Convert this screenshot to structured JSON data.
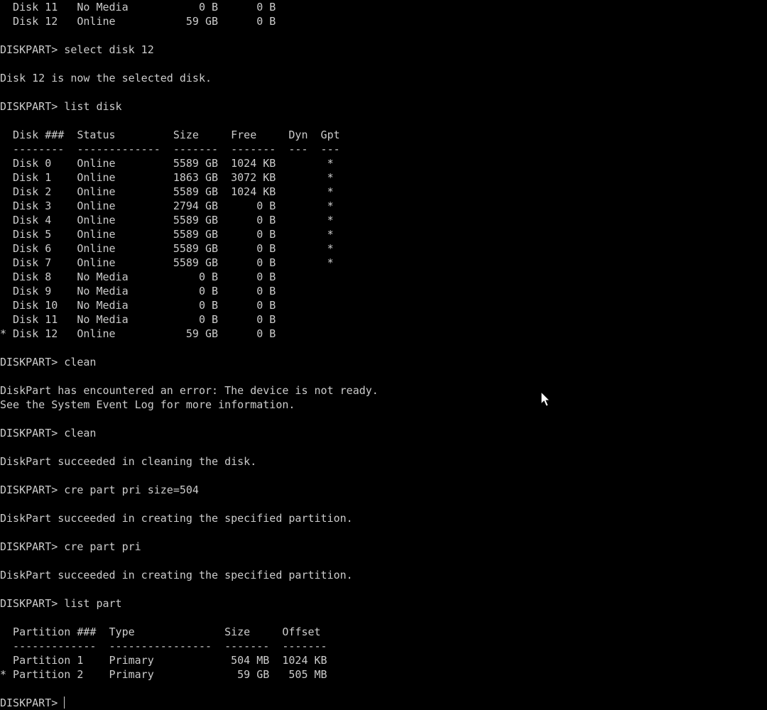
{
  "window": {
    "background": "#000000",
    "foreground": "#cccccc"
  },
  "lines": [
    "  Disk 11   No Media           0 B      0 B",
    "  Disk 12   Online           59 GB      0 B",
    "",
    "DISKPART> select disk 12",
    "",
    "Disk 12 is now the selected disk.",
    "",
    "DISKPART> list disk",
    "",
    "  Disk ###  Status         Size     Free     Dyn  Gpt",
    "  --------  -------------  -------  -------  ---  ---",
    "  Disk 0    Online         5589 GB  1024 KB        *",
    "  Disk 1    Online         1863 GB  3072 KB        *",
    "  Disk 2    Online         5589 GB  1024 KB        *",
    "  Disk 3    Online         2794 GB      0 B        *",
    "  Disk 4    Online         5589 GB      0 B        *",
    "  Disk 5    Online         5589 GB      0 B        *",
    "  Disk 6    Online         5589 GB      0 B        *",
    "  Disk 7    Online         5589 GB      0 B        *",
    "  Disk 8    No Media           0 B      0 B",
    "  Disk 9    No Media           0 B      0 B",
    "  Disk 10   No Media           0 B      0 B",
    "  Disk 11   No Media           0 B      0 B",
    "* Disk 12   Online           59 GB      0 B",
    "",
    "DISKPART> clean",
    "",
    "DiskPart has encountered an error: The device is not ready.",
    "See the System Event Log for more information.",
    "",
    "DISKPART> clean",
    "",
    "DiskPart succeeded in cleaning the disk.",
    "",
    "DISKPART> cre part pri size=504",
    "",
    "DiskPart succeeded in creating the specified partition.",
    "",
    "DISKPART> cre part pri",
    "",
    "DiskPart succeeded in creating the specified partition.",
    "",
    "DISKPART> list part",
    "",
    "  Partition ###  Type              Size     Offset",
    "  -------------  ----------------  -------  -------",
    "  Partition 1    Primary            504 MB  1024 KB",
    "* Partition 2    Primary             59 GB   505 MB",
    ""
  ],
  "prompt": {
    "label": "DISKPART> ",
    "input": ""
  },
  "icons": {
    "cursor": "mouse-pointer-icon"
  }
}
